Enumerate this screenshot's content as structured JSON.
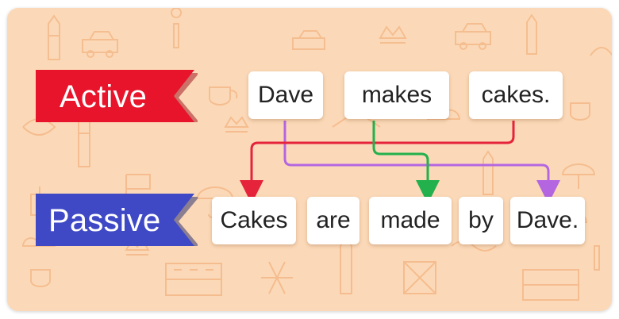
{
  "colors": {
    "background": "#fbd9b8",
    "pattern": "#f4b989",
    "active_ribbon": "#e8142b",
    "passive_ribbon": "#3f49c6",
    "arrow_red": "#e5233b",
    "arrow_green": "#22b14c",
    "arrow_purple": "#b466e0"
  },
  "active": {
    "label": "Active",
    "words": [
      "Dave",
      "makes",
      "cakes."
    ]
  },
  "passive": {
    "label": "Passive",
    "words": [
      "Cakes",
      "are",
      "made",
      "by",
      "Dave."
    ]
  }
}
